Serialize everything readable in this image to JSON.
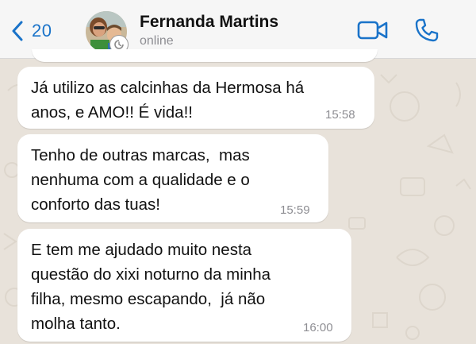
{
  "header": {
    "back_count": "20",
    "contact_name": "Fernanda Martins",
    "contact_status": "online"
  },
  "messages": [
    {
      "text": "Já utilizo as calcinhas da Hermosa há\nanos, e AMO!! É vida!!",
      "time": "15:58"
    },
    {
      "text": "Tenho de outras marcas,  mas\nnenhuma com a qualidade e o\nconforto das tuas!",
      "time": "15:59"
    },
    {
      "text": "E tem me ajudado muito nesta\nquestão do xixi noturno da minha\nfilha, mesmo escapando,  já não\nmolha tanto.",
      "time": "16:00"
    }
  ],
  "colors": {
    "accent": "#1a73c9",
    "chat_background": "#e8e2da",
    "bubble": "#ffffff",
    "timestamp": "#8e8e93"
  },
  "icons": [
    "chevron-left-icon",
    "video-camera-icon",
    "phone-icon",
    "sync-badge-icon"
  ]
}
